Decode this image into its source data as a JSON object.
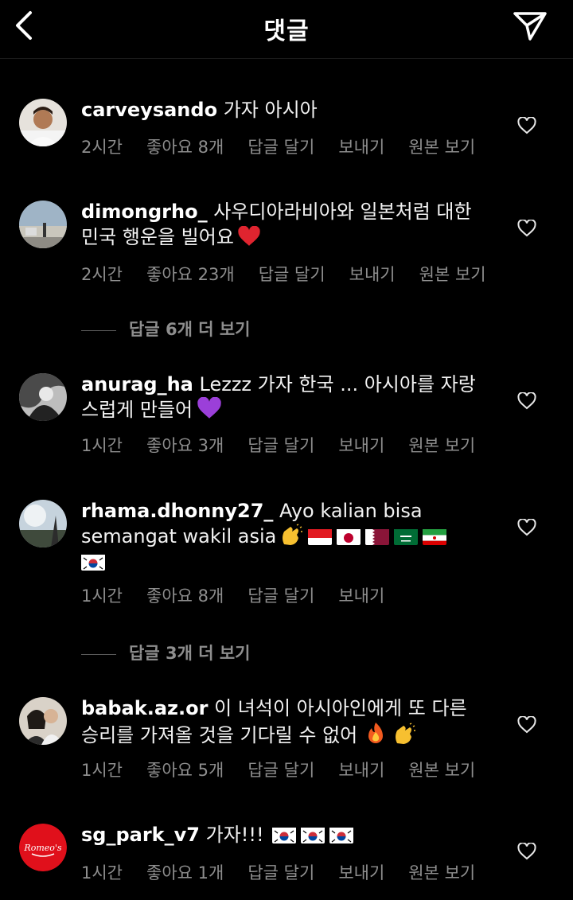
{
  "header": {
    "title": "댓글"
  },
  "meta_labels": {
    "likes_prefix": "좋아요",
    "reply": "답글 달기",
    "send": "보내기",
    "original": "원본 보기"
  },
  "comments": [
    {
      "username": "carveysando",
      "text1": "가자 아시아",
      "time": "2시간",
      "likes": "좋아요 8개"
    },
    {
      "username": "dimongrho_",
      "text1": "사우디아라비아와 일본처럼 대한",
      "text2": "민국 행운을 빌어요",
      "time": "2시간",
      "likes": "좋아요 23개"
    },
    {
      "username": "anurag_ha",
      "text1": "Lezzz 가자 한국 ... 아시아를 자랑",
      "text2": "스럽게 만들어",
      "time": "1시간",
      "likes": "좋아요 3개"
    },
    {
      "username": "rhama.dhonny27_",
      "text1": "Ayo kalian bisa",
      "text2": "semangat wakil asia",
      "time": "1시간",
      "likes": "좋아요 8개"
    },
    {
      "username": "babak.az.or",
      "text1": "이 녀석이 아시아인에게 또 다른",
      "text2": "승리를 가져올 것을 기다릴 수 없어",
      "time": "1시간",
      "likes": "좋아요 5개"
    },
    {
      "username": "sg_park_v7",
      "text1": "가자!!!",
      "time": "1시간",
      "likes": "좋아요 1개"
    }
  ],
  "view_more": [
    {
      "label": "답글 6개 더 보기"
    },
    {
      "label": "답글 3개 더 보기"
    }
  ],
  "avatar_badge_text": "Romeo's",
  "icons": [
    "back-arrow-icon",
    "send-icon",
    "heart-icon",
    "red-heart-emoji",
    "purple-heart-emoji",
    "clapping-hands-emoji",
    "fire-emoji",
    "flag-indonesia",
    "flag-japan",
    "flag-qatar",
    "flag-saudi-arabia",
    "flag-iran",
    "flag-south-korea"
  ],
  "colors": {
    "background": "#000000",
    "text": "#f5f5f5",
    "secondary": "#8e8e8e"
  }
}
